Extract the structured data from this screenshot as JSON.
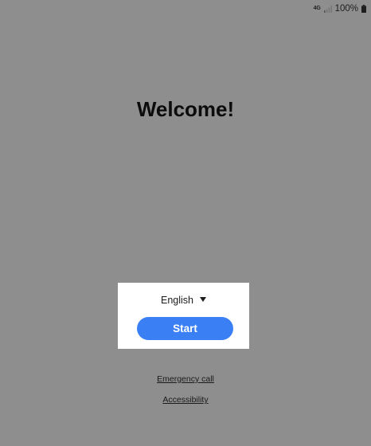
{
  "status_bar": {
    "network": "4G",
    "battery": "100%",
    "signal_icon": "signal-bars-icon",
    "battery_icon": "battery-icon"
  },
  "welcome": {
    "title": "Welcome!"
  },
  "setup": {
    "language": "English",
    "dropdown_icon": "triangle-down-icon",
    "start_label": "Start"
  },
  "links": {
    "emergency_call": "Emergency call",
    "accessibility": "Accessibility"
  },
  "colors": {
    "background": "#8e8e8e",
    "accent": "#3b7ff5",
    "card": "#ffffff"
  }
}
